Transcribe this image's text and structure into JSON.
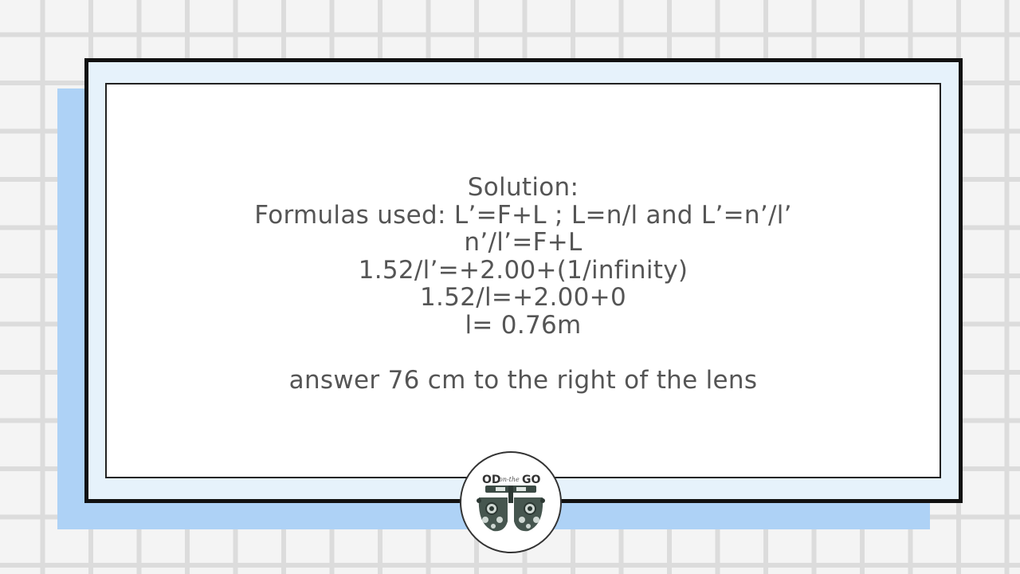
{
  "slide": {
    "title": "Solution:",
    "lines": [
      "Formulas used: L’=F+L ; L=n/l and L’=n’/l’",
      "n’/l’=F+L",
      "1.52/l’=+2.00+(1/infinity)",
      "1.52/l=+2.00+0",
      "l= 0.76m"
    ],
    "answer": "answer 76 cm to the right of the lens"
  },
  "logo": {
    "text_od": "OD",
    "text_on_the": "on-the",
    "text_go": "GO",
    "icon": "phoropter-icon"
  },
  "colors": {
    "background": "#f4f4f4",
    "grid": "#dcdcdc",
    "shadow_panel": "#aed2f6",
    "frame_fill": "#e6f2fb",
    "border": "#111111",
    "text": "#555555"
  }
}
